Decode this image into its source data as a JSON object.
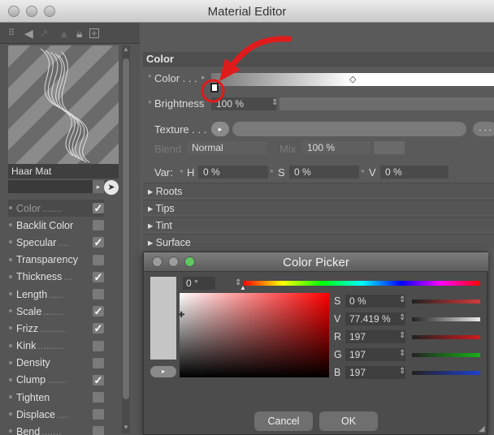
{
  "window": {
    "title": "Material Editor"
  },
  "material": {
    "name": "Haar Mat",
    "channels": [
      {
        "label": "Color",
        "checked": true,
        "active": true
      },
      {
        "label": "Backlit Color",
        "checked": false
      },
      {
        "label": "Specular",
        "checked": true
      },
      {
        "label": "Transparency",
        "checked": false
      },
      {
        "label": "Thickness",
        "checked": true
      },
      {
        "label": "Length",
        "checked": false
      },
      {
        "label": "Scale",
        "checked": true
      },
      {
        "label": "Frizz",
        "checked": true
      },
      {
        "label": "Kink",
        "checked": false
      },
      {
        "label": "Density",
        "checked": false
      },
      {
        "label": "Clump",
        "checked": true
      },
      {
        "label": "Tighten",
        "checked": false
      },
      {
        "label": "Displace",
        "checked": false
      },
      {
        "label": "Bend",
        "checked": false
      }
    ],
    "channel_dots": [
      ".......",
      "",
      "....",
      "",
      "...",
      ".....",
      ".......",
      ".........",
      ".........",
      "",
      ".......",
      "",
      "....",
      "......."
    ]
  },
  "panel": {
    "header": "Color",
    "color_label": "Color . . .",
    "brightness_label": "Brightness",
    "brightness_value": "100 %",
    "texture_label": "Texture . . .",
    "texture_more": ". . .",
    "blend_label": "Blend",
    "blend_value": "Normal",
    "mix_label": "Mix",
    "mix_value": "100 %",
    "var_label": "Var:",
    "var_h_label": "H",
    "var_h": "0 %",
    "var_s_label": "S",
    "var_s": "0 %",
    "var_v_label": "V",
    "var_v": "0 %",
    "sections": [
      "Roots",
      "Tips",
      "Tint",
      "Surface"
    ]
  },
  "picker": {
    "title": "Color Picker",
    "hue": "0 °",
    "channels": [
      {
        "label": "S",
        "value": "0 %",
        "color": "#d23a3a"
      },
      {
        "label": "V",
        "value": "77.419 %",
        "color": "#e8e8e8"
      },
      {
        "label": "R",
        "value": "197",
        "color": "#d01a1a"
      },
      {
        "label": "G",
        "value": "197",
        "color": "#17b017"
      },
      {
        "label": "B",
        "value": "197",
        "color": "#2040d0"
      }
    ],
    "cancel": "Cancel",
    "ok": "OK",
    "swatch_color": "#c5c5c5"
  }
}
